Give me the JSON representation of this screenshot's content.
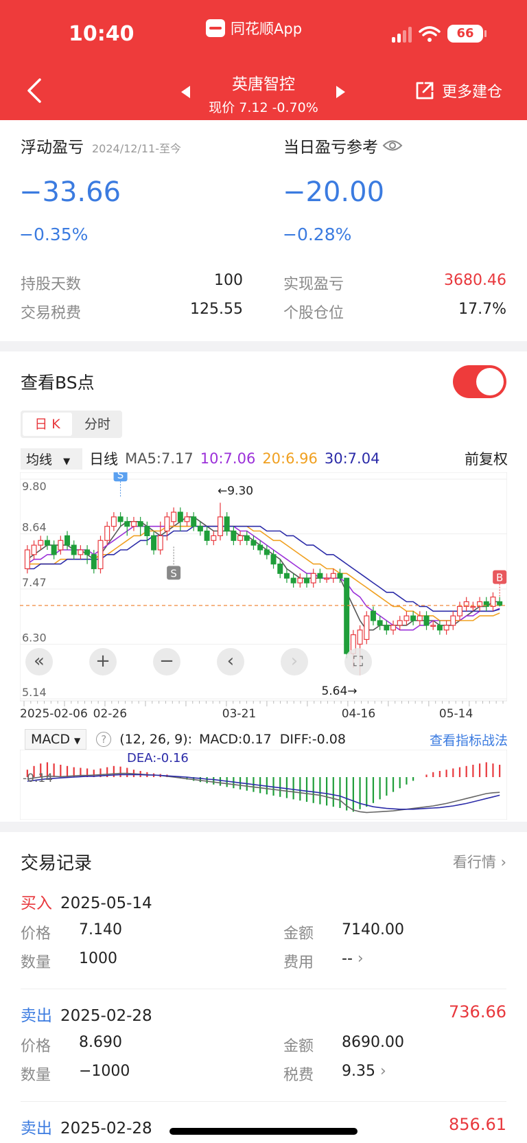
{
  "status": {
    "time": "10:40",
    "battery": "66",
    "app_badge": "同花顺App"
  },
  "header": {
    "stock_name": "英唐智控",
    "price_line": "现价 7.12 -0.70%",
    "more_label": "更多建仓"
  },
  "summary": {
    "float_label": "浮动盈亏",
    "float_period": "2024/12/11-至今",
    "float_value": "−33.66",
    "float_pct": "−0.35%",
    "day_label": "当日盈亏参考",
    "day_value": "−20.00",
    "day_pct": "−0.28%",
    "hold_days_label": "持股天数",
    "hold_days": "100",
    "tax_label": "交易税费",
    "tax": "125.55",
    "realized_label": "实现盈亏",
    "realized": "3680.46",
    "position_label": "个股仓位",
    "position": "17.7%"
  },
  "bs": {
    "title": "查看BS点",
    "toggle_on": true,
    "tab_k": "日 K",
    "tab_time": "分时"
  },
  "ma": {
    "selector": "均线",
    "period": "日线",
    "ma5": "MA5:7.17",
    "ma10": "10:7.06",
    "ma20": "20:6.96",
    "ma30": "30:7.04",
    "fq": "前复权"
  },
  "colors": {
    "red": "#e8383d",
    "green": "#1f9e3a",
    "ma5": "#555555",
    "ma10": "#9b30d9",
    "ma20": "#f0a020",
    "ma30": "#2b2ba8",
    "blue_text": "#3b7be0"
  },
  "chart_data": {
    "type": "candlestick",
    "y_ticks": [
      "9.80",
      "8.64",
      "7.47",
      "6.30",
      "5.14"
    ],
    "ylim": [
      5.14,
      9.8
    ],
    "x_ticks": [
      "2025-02-06",
      "02-26",
      "03-21",
      "04-16",
      "05-14"
    ],
    "high_marker": "←9.30",
    "low_marker": "5.64→",
    "current_price": 7.12,
    "buy_label": "B",
    "sell_label": "S",
    "candles": [
      [
        7.9,
        8.3,
        8.4,
        7.8
      ],
      [
        8.2,
        8.4,
        8.5,
        8.1
      ],
      [
        8.4,
        8.5,
        8.6,
        8.3
      ],
      [
        8.5,
        8.4,
        8.6,
        8.3
      ],
      [
        8.4,
        8.2,
        8.5,
        8.1
      ],
      [
        8.3,
        8.5,
        8.6,
        8.2
      ],
      [
        8.6,
        8.4,
        8.7,
        8.3
      ],
      [
        8.4,
        8.2,
        8.5,
        8.1
      ],
      [
        8.2,
        8.3,
        8.4,
        8.1
      ],
      [
        8.3,
        8.2,
        8.4,
        8.0
      ],
      [
        8.2,
        7.9,
        8.3,
        7.8
      ],
      [
        7.9,
        8.5,
        8.6,
        7.8
      ],
      [
        8.5,
        8.8,
        8.9,
        8.4
      ],
      [
        8.8,
        9.0,
        9.1,
        8.7
      ],
      [
        9.0,
        8.9,
        9.1,
        8.8
      ],
      [
        8.9,
        8.8,
        9.0,
        8.6
      ],
      [
        8.8,
        8.9,
        9.0,
        8.7
      ],
      [
        8.9,
        8.8,
        9.0,
        8.6
      ],
      [
        8.8,
        8.6,
        8.9,
        8.4
      ],
      [
        8.6,
        8.3,
        8.7,
        8.2
      ],
      [
        8.3,
        8.6,
        8.9,
        8.2
      ],
      [
        8.7,
        9.0,
        9.1,
        8.5
      ],
      [
        8.9,
        9.1,
        9.2,
        8.8
      ],
      [
        9.1,
        8.9,
        9.2,
        8.7
      ],
      [
        8.9,
        9.0,
        9.1,
        8.8
      ],
      [
        9.0,
        8.8,
        9.1,
        8.7
      ],
      [
        8.8,
        8.7,
        8.9,
        8.6
      ],
      [
        8.7,
        8.5,
        8.8,
        8.4
      ],
      [
        8.5,
        8.6,
        8.7,
        8.4
      ],
      [
        8.6,
        9.0,
        9.3,
        8.5
      ],
      [
        9.0,
        8.7,
        9.1,
        8.6
      ],
      [
        8.7,
        8.5,
        8.8,
        8.4
      ],
      [
        8.5,
        8.6,
        8.7,
        8.4
      ],
      [
        8.6,
        8.5,
        8.7,
        8.4
      ],
      [
        8.5,
        8.4,
        8.6,
        8.3
      ],
      [
        8.4,
        8.3,
        8.5,
        8.2
      ],
      [
        8.3,
        8.2,
        8.4,
        8.1
      ],
      [
        8.2,
        8.0,
        8.3,
        7.9
      ],
      [
        8.0,
        7.8,
        8.1,
        7.7
      ],
      [
        7.8,
        7.7,
        7.9,
        7.6
      ],
      [
        7.7,
        7.6,
        7.8,
        7.5
      ],
      [
        7.6,
        7.7,
        7.8,
        7.5
      ],
      [
        7.7,
        7.6,
        7.8,
        7.5
      ],
      [
        7.6,
        7.8,
        7.9,
        7.5
      ],
      [
        7.8,
        7.7,
        7.9,
        7.6
      ],
      [
        7.7,
        7.7,
        7.8,
        7.6
      ],
      [
        7.7,
        7.8,
        7.9,
        7.6
      ],
      [
        7.8,
        7.7,
        7.9,
        7.6
      ],
      [
        7.7,
        6.1,
        7.1,
        6.0
      ],
      [
        6.1,
        6.5,
        6.6,
        5.8
      ],
      [
        6.3,
        6.6,
        6.7,
        5.64
      ],
      [
        6.4,
        6.9,
        7.0,
        6.3
      ],
      [
        7.0,
        6.8,
        7.1,
        6.7
      ],
      [
        6.8,
        6.7,
        6.9,
        6.6
      ],
      [
        6.7,
        6.6,
        6.8,
        6.5
      ],
      [
        6.6,
        6.7,
        6.8,
        6.5
      ],
      [
        6.7,
        6.8,
        6.9,
        6.6
      ],
      [
        6.8,
        6.9,
        7.0,
        6.7
      ],
      [
        6.9,
        6.8,
        7.0,
        6.7
      ],
      [
        6.8,
        6.9,
        7.0,
        6.7
      ],
      [
        6.9,
        6.7,
        7.0,
        6.6
      ],
      [
        6.7,
        6.7,
        6.8,
        6.6
      ],
      [
        6.7,
        6.6,
        6.8,
        6.5
      ],
      [
        6.6,
        6.7,
        6.8,
        6.5
      ],
      [
        6.7,
        6.9,
        7.0,
        6.6
      ],
      [
        6.9,
        7.1,
        7.2,
        6.8
      ],
      [
        7.1,
        7.2,
        7.3,
        7.0
      ],
      [
        7.1,
        7.1,
        7.2,
        7.0
      ],
      [
        7.1,
        7.2,
        7.3,
        7.0
      ],
      [
        7.2,
        7.1,
        7.3,
        7.0
      ],
      [
        7.1,
        7.3,
        7.4,
        7.0
      ],
      [
        7.2,
        7.12,
        7.3,
        7.1
      ]
    ],
    "bs_points": [
      {
        "type": "S",
        "index": 14,
        "price": 9.2
      },
      {
        "type": "S",
        "index": 22,
        "price": 8.6
      },
      {
        "type": "B",
        "index": 71,
        "price": 7.14
      }
    ],
    "ma_lines": {
      "ma5": [
        8.1,
        8.2,
        8.3,
        8.4,
        8.4,
        8.4,
        8.4,
        8.3,
        8.3,
        8.2,
        8.1,
        8.2,
        8.4,
        8.6,
        8.8,
        8.9,
        8.9,
        8.9,
        8.8,
        8.7,
        8.6,
        8.7,
        8.8,
        8.9,
        9.0,
        9.0,
        8.9,
        8.8,
        8.7,
        8.7,
        8.7,
        8.7,
        8.6,
        8.6,
        8.5,
        8.4,
        8.3,
        8.2,
        8.1,
        7.9,
        7.8,
        7.7,
        7.7,
        7.7,
        7.7,
        7.7,
        7.7,
        7.7,
        7.4,
        7.1,
        6.8,
        6.6,
        6.6,
        6.7,
        6.7,
        6.7,
        6.7,
        6.7,
        6.8,
        6.8,
        6.8,
        6.8,
        6.7,
        6.7,
        6.7,
        6.8,
        6.9,
        7.0,
        7.1,
        7.1,
        7.2,
        7.2
      ],
      "ma10": [
        8.0,
        8.1,
        8.1,
        8.2,
        8.2,
        8.3,
        8.3,
        8.3,
        8.3,
        8.3,
        8.2,
        8.3,
        8.4,
        8.5,
        8.6,
        8.7,
        8.8,
        8.8,
        8.8,
        8.8,
        8.8,
        8.8,
        8.8,
        8.8,
        8.8,
        8.8,
        8.8,
        8.8,
        8.8,
        8.8,
        8.8,
        8.8,
        8.7,
        8.7,
        8.6,
        8.5,
        8.4,
        8.3,
        8.2,
        8.1,
        8.0,
        7.9,
        7.8,
        7.8,
        7.7,
        7.7,
        7.7,
        7.7,
        7.6,
        7.4,
        7.3,
        7.1,
        7.0,
        6.9,
        6.8,
        6.7,
        6.6,
        6.6,
        6.6,
        6.7,
        6.7,
        6.8,
        6.8,
        6.8,
        6.8,
        6.8,
        6.9,
        6.9,
        7.0,
        7.0,
        7.0,
        7.06
      ],
      "ma20": [
        8.0,
        8.0,
        8.0,
        8.0,
        8.0,
        8.1,
        8.1,
        8.1,
        8.1,
        8.1,
        8.1,
        8.2,
        8.2,
        8.3,
        8.4,
        8.5,
        8.6,
        8.6,
        8.7,
        8.7,
        8.7,
        8.8,
        8.8,
        8.8,
        8.8,
        8.8,
        8.8,
        8.8,
        8.8,
        8.8,
        8.8,
        8.8,
        8.8,
        8.8,
        8.7,
        8.7,
        8.6,
        8.5,
        8.5,
        8.4,
        8.3,
        8.2,
        8.1,
        8.0,
        8.0,
        7.9,
        7.9,
        7.8,
        7.8,
        7.7,
        7.6,
        7.5,
        7.4,
        7.3,
        7.2,
        7.1,
        7.1,
        7.0,
        7.0,
        6.9,
        6.9,
        6.9,
        6.8,
        6.8,
        6.8,
        6.8,
        6.8,
        6.8,
        6.9,
        6.9,
        6.9,
        6.96
      ],
      "ma30": [
        7.9,
        7.9,
        8.0,
        8.0,
        8.0,
        8.0,
        8.1,
        8.1,
        8.1,
        8.1,
        8.1,
        8.1,
        8.2,
        8.2,
        8.3,
        8.3,
        8.4,
        8.5,
        8.5,
        8.6,
        8.6,
        8.6,
        8.7,
        8.7,
        8.7,
        8.8,
        8.8,
        8.8,
        8.8,
        8.8,
        8.8,
        8.8,
        8.8,
        8.8,
        8.8,
        8.8,
        8.7,
        8.7,
        8.7,
        8.6,
        8.6,
        8.5,
        8.4,
        8.4,
        8.3,
        8.2,
        8.2,
        8.1,
        8.0,
        7.9,
        7.8,
        7.7,
        7.6,
        7.5,
        7.4,
        7.4,
        7.3,
        7.2,
        7.2,
        7.1,
        7.1,
        7.0,
        7.0,
        7.0,
        7.0,
        7.0,
        7.0,
        7.0,
        7.0,
        7.0,
        7.0,
        7.04
      ]
    }
  },
  "macd": {
    "selector": "MACD",
    "params": "(12, 26, 9):",
    "macd": "MACD:0.17",
    "diff": "DIFF:-0.08",
    "dea": "DEA:-0.16",
    "axis": "-0.14",
    "link": "查看指标战法",
    "hist": [
      0.12,
      0.18,
      0.22,
      0.24,
      0.22,
      0.2,
      0.18,
      0.16,
      0.15,
      0.14,
      0.12,
      0.14,
      0.16,
      0.18,
      0.17,
      0.15,
      0.12,
      0.1,
      0.08,
      0.06,
      0.05,
      0.04,
      0.02,
      -0.02,
      -0.04,
      -0.06,
      -0.08,
      -0.1,
      -0.12,
      -0.14,
      -0.16,
      -0.18,
      -0.2,
      -0.22,
      -0.24,
      -0.26,
      -0.28,
      -0.3,
      -0.32,
      -0.34,
      -0.36,
      -0.38,
      -0.4,
      -0.42,
      -0.44,
      -0.46,
      -0.48,
      -0.5,
      -0.54,
      -0.56,
      -0.52,
      -0.48,
      -0.42,
      -0.36,
      -0.3,
      -0.24,
      -0.18,
      -0.12,
      -0.06,
      0.0,
      0.04,
      0.08,
      0.1,
      0.12,
      0.14,
      0.16,
      0.18,
      0.2,
      0.22,
      0.24,
      0.22,
      0.2
    ],
    "diff_line": [
      0.05,
      0.08,
      0.1,
      0.12,
      0.12,
      0.11,
      0.12,
      0.13,
      0.14,
      0.14,
      0.15,
      0.16,
      0.17,
      0.18,
      0.19,
      0.19,
      0.18,
      0.17,
      0.16,
      0.15,
      0.14,
      0.12,
      0.1,
      0.08,
      0.06,
      0.04,
      0.02,
      0.0,
      -0.02,
      -0.04,
      -0.06,
      -0.08,
      -0.1,
      -0.12,
      -0.14,
      -0.16,
      -0.18,
      -0.2,
      -0.22,
      -0.24,
      -0.26,
      -0.28,
      -0.3,
      -0.32,
      -0.34,
      -0.38,
      -0.42,
      -0.46,
      -0.6,
      -0.7,
      -0.74,
      -0.76,
      -0.75,
      -0.74,
      -0.73,
      -0.72,
      -0.7,
      -0.68,
      -0.66,
      -0.64,
      -0.62,
      -0.6,
      -0.57,
      -0.54,
      -0.5,
      -0.46,
      -0.42,
      -0.38,
      -0.34,
      -0.3,
      -0.28,
      -0.27
    ],
    "dea_line": [
      0.0,
      0.02,
      0.04,
      0.06,
      0.07,
      0.08,
      0.09,
      0.1,
      0.11,
      0.12,
      0.12,
      0.13,
      0.14,
      0.15,
      0.16,
      0.16,
      0.16,
      0.16,
      0.15,
      0.15,
      0.14,
      0.13,
      0.12,
      0.11,
      0.1,
      0.08,
      0.07,
      0.05,
      0.04,
      0.02,
      0.0,
      -0.02,
      -0.04,
      -0.06,
      -0.08,
      -0.1,
      -0.12,
      -0.14,
      -0.16,
      -0.18,
      -0.2,
      -0.22,
      -0.24,
      -0.26,
      -0.28,
      -0.3,
      -0.33,
      -0.36,
      -0.42,
      -0.48,
      -0.54,
      -0.58,
      -0.62,
      -0.64,
      -0.66,
      -0.67,
      -0.68,
      -0.68,
      -0.68,
      -0.67,
      -0.66,
      -0.65,
      -0.64,
      -0.62,
      -0.6,
      -0.57,
      -0.54,
      -0.5,
      -0.46,
      -0.42,
      -0.38,
      -0.34
    ]
  },
  "records": {
    "title": "交易记录",
    "link": "看行情",
    "items": [
      {
        "type": "买入",
        "date": "2025-05-14",
        "price_label": "价格",
        "price": "7.140",
        "qty_label": "数量",
        "qty": "1000",
        "amount_label": "金额",
        "amount": "7140.00",
        "fee_label": "费用",
        "fee": "--",
        "pnl": ""
      },
      {
        "type": "卖出",
        "date": "2025-02-28",
        "price_label": "价格",
        "price": "8.690",
        "qty_label": "数量",
        "qty": "−1000",
        "amount_label": "金额",
        "amount": "8690.00",
        "fee_label": "税费",
        "fee": "9.35",
        "pnl": "736.66"
      },
      {
        "type": "卖出",
        "date": "2025-02-28",
        "pnl": "856.61"
      }
    ]
  }
}
